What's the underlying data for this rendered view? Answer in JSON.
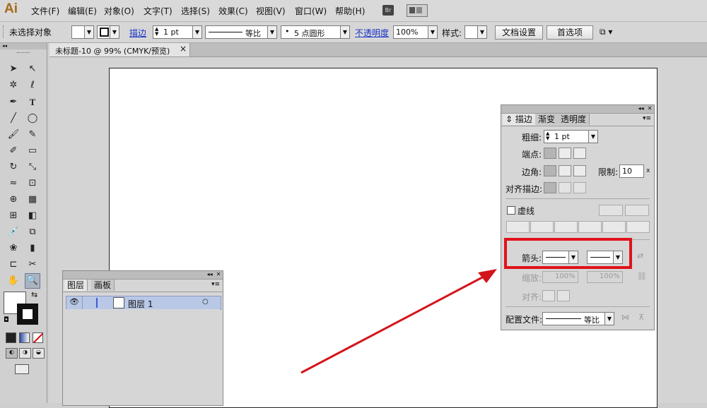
{
  "app": {
    "logo": "Ai",
    "bridge_icon": "Br"
  },
  "menu": [
    "文件(F)",
    "编辑(E)",
    "对象(O)",
    "文字(T)",
    "选择(S)",
    "效果(C)",
    "视图(V)",
    "窗口(W)",
    "帮助(H)"
  ],
  "control": {
    "selection_status": "未选择对象",
    "stroke_link": "描边",
    "stroke_weight": "1 pt",
    "profile_label": "等比",
    "brush_label": "5 点圆形",
    "opacity_link": "不透明度",
    "opacity_value": "100%",
    "style_label": "样式:",
    "doc_setup": "文档设置",
    "preferences": "首选项"
  },
  "document": {
    "tab_title": "未标题-10 @ 99% (CMYK/预览)",
    "close": "×"
  },
  "layers_panel": {
    "tabs": [
      "图层",
      "画板"
    ],
    "layer_name": "图层 1"
  },
  "stroke_panel": {
    "tabs": [
      "描边",
      "渐变",
      "透明度"
    ],
    "weight_label": "粗细:",
    "weight_value": "1 pt",
    "cap_label": "端点:",
    "corner_label": "边角:",
    "limit_label": "限制:",
    "limit_value": "10",
    "limit_unit": "x",
    "align_label": "对齐描边:",
    "dashed_label": "虚线",
    "arrowheads_label": "箭头:",
    "scale_label": "缩放:",
    "scale_start": "100%",
    "scale_end": "100%",
    "align_arrow_label": "对齐:",
    "profile_label": "配置文件:",
    "profile_value": "等比"
  },
  "colors": {
    "highlight": "#e0121b",
    "arrow": "#d4141c",
    "logo": "#a36a1a"
  }
}
